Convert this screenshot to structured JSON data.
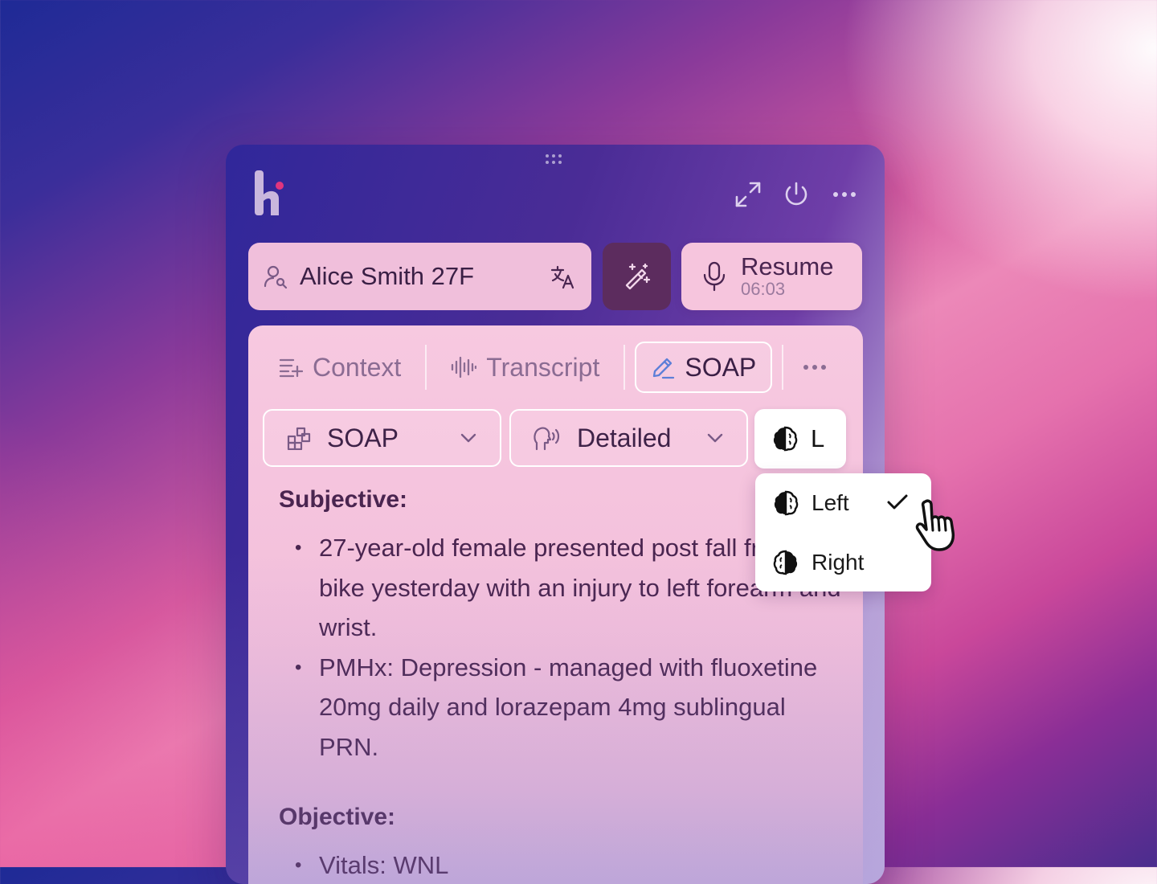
{
  "header": {
    "logo": "app-logo",
    "icons": [
      "expand-icon",
      "power-icon",
      "more-icon"
    ]
  },
  "patient": {
    "name": "Alice Smith 27F",
    "icon": "user-search-icon",
    "translate_icon": "translate-icon"
  },
  "magic": {
    "icon": "magic-wand-icon"
  },
  "recording": {
    "label": "Resume",
    "time": "06:03",
    "icon": "microphone-icon"
  },
  "tabs": [
    {
      "label": "Context",
      "icon": "list-add-icon",
      "active": false
    },
    {
      "label": "Transcript",
      "icon": "waveform-icon",
      "active": false
    },
    {
      "label": "SOAP",
      "icon": "pencil-icon",
      "active": true
    }
  ],
  "dropdowns": {
    "template": "SOAP",
    "style": "Detailed",
    "side": "L"
  },
  "side_menu": {
    "options": [
      "Left",
      "Right"
    ],
    "selected": "Left"
  },
  "note": {
    "subjective": {
      "heading": "Subjective:",
      "bullets": [
        "27-year-old female presented post fall from bike yesterday with an injury to left forearm and wrist.",
        "PMHx: Depression - managed with fluoxetine 20mg daily and lorazepam 4mg sublingual PRN."
      ]
    },
    "objective": {
      "heading": "Objective:",
      "bullets": [
        "Vitals: WNL"
      ]
    }
  },
  "colors": {
    "accent": "#5c2c5e",
    "text": "#4a2550",
    "logo_dot": "#e0357e"
  }
}
